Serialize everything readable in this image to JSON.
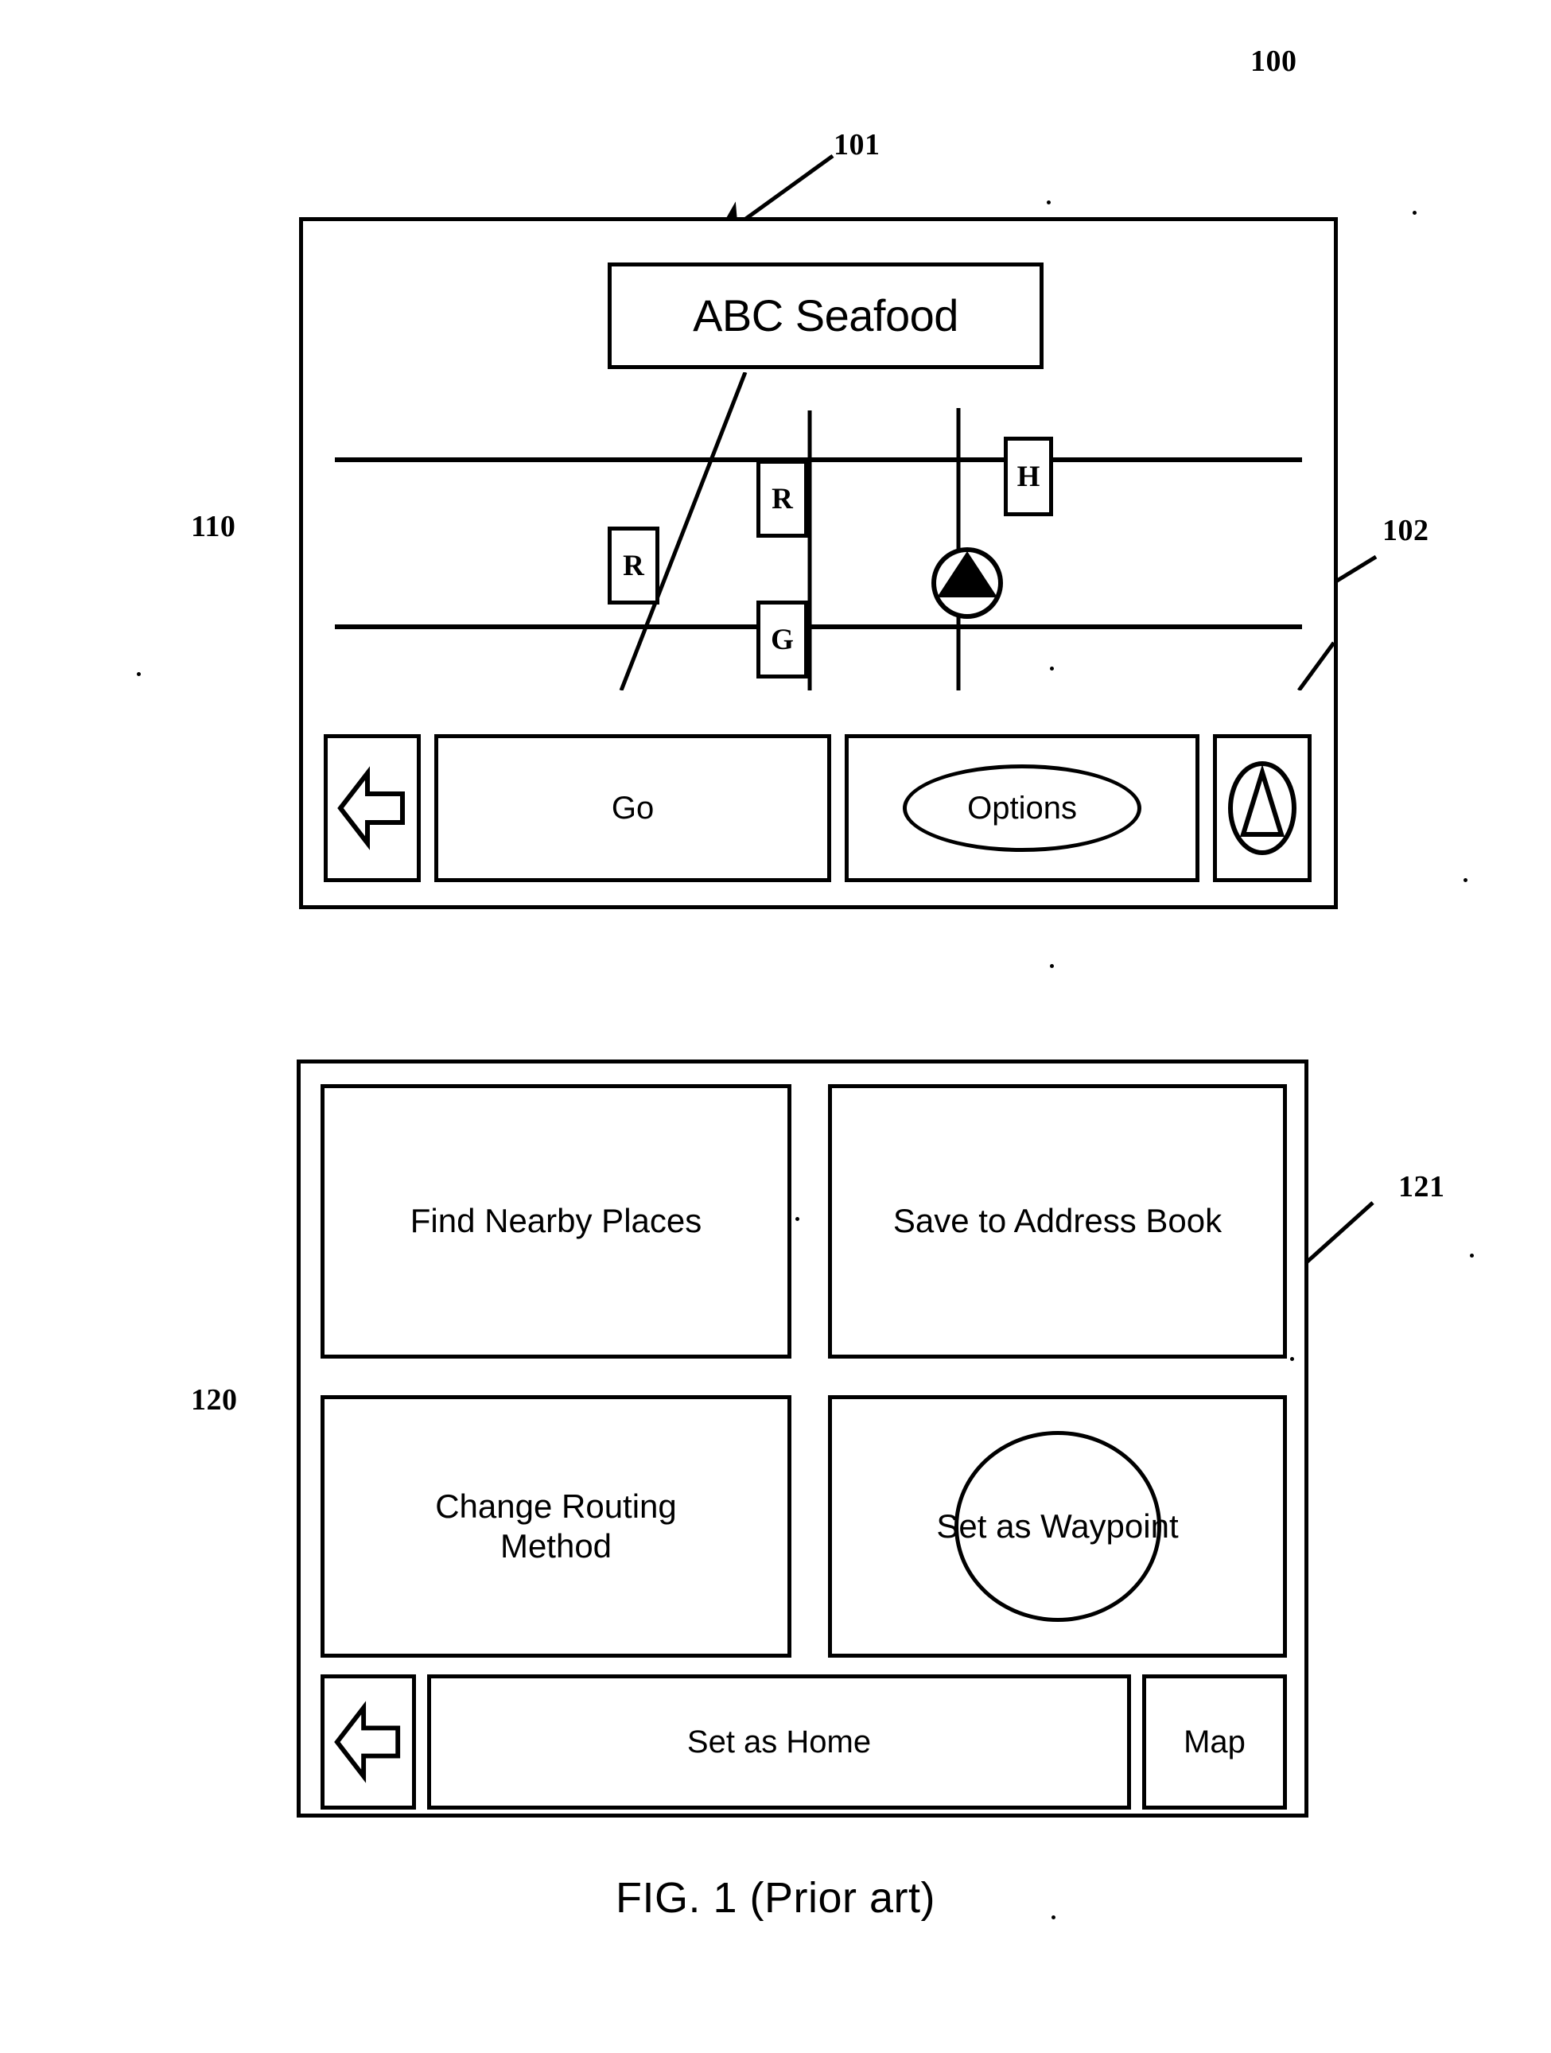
{
  "figure": {
    "caption": "FIG. 1 (Prior art)",
    "refs": {
      "r100": "100",
      "r101": "101",
      "r102": "102",
      "r110": "110",
      "r120": "120",
      "r121": "121"
    }
  },
  "screen_110": {
    "title_bar": {
      "label": "ABC Seafood"
    },
    "map": {
      "pois": [
        {
          "id": "poi-r-top",
          "label": "R",
          "meaning": "restaurant-marker"
        },
        {
          "id": "poi-r-left",
          "label": "R",
          "meaning": "restaurant-marker"
        },
        {
          "id": "poi-g",
          "label": "G",
          "meaning": "gas-station-marker"
        },
        {
          "id": "poi-h",
          "label": "H",
          "meaning": "hotel-marker"
        }
      ],
      "vehicle_icon": "vehicle-position-icon"
    },
    "buttons": [
      {
        "id": "btn-back-110",
        "label": "",
        "icon": "back-arrow-icon"
      },
      {
        "id": "btn-go",
        "label": "Go",
        "icon": ""
      },
      {
        "id": "btn-options",
        "label": "Options",
        "icon": ""
      },
      {
        "id": "btn-compass-110",
        "label": "",
        "icon": "compass-north-icon"
      }
    ],
    "labels": {
      "go": "Go",
      "options": "Options"
    }
  },
  "screen_120": {
    "options": [
      {
        "id": "opt-find",
        "label": "Find Nearby Places"
      },
      {
        "id": "opt-save",
        "label": "Save to Address Book"
      },
      {
        "id": "opt-routing",
        "label": "Change Routing\nMethod"
      },
      {
        "id": "opt-waypoint",
        "label": "Set as Waypoint"
      }
    ],
    "labels": {
      "find_nearby_places": "Find Nearby Places",
      "save_to_address_book": "Save to Address Book",
      "change_routing_method_line1": "Change Routing",
      "change_routing_method_line2": "Method",
      "set_as_waypoint": "Set as Waypoint",
      "set_as_home": "Set as Home",
      "map": "Map"
    },
    "buttons": [
      {
        "id": "btn-back-120",
        "label": "",
        "icon": "back-arrow-icon"
      },
      {
        "id": "btn-set-home",
        "label": "Set as Home",
        "icon": ""
      },
      {
        "id": "btn-map",
        "label": "Map",
        "icon": ""
      }
    ]
  },
  "colors": {
    "ink": "#000000",
    "paper": "#ffffff"
  }
}
